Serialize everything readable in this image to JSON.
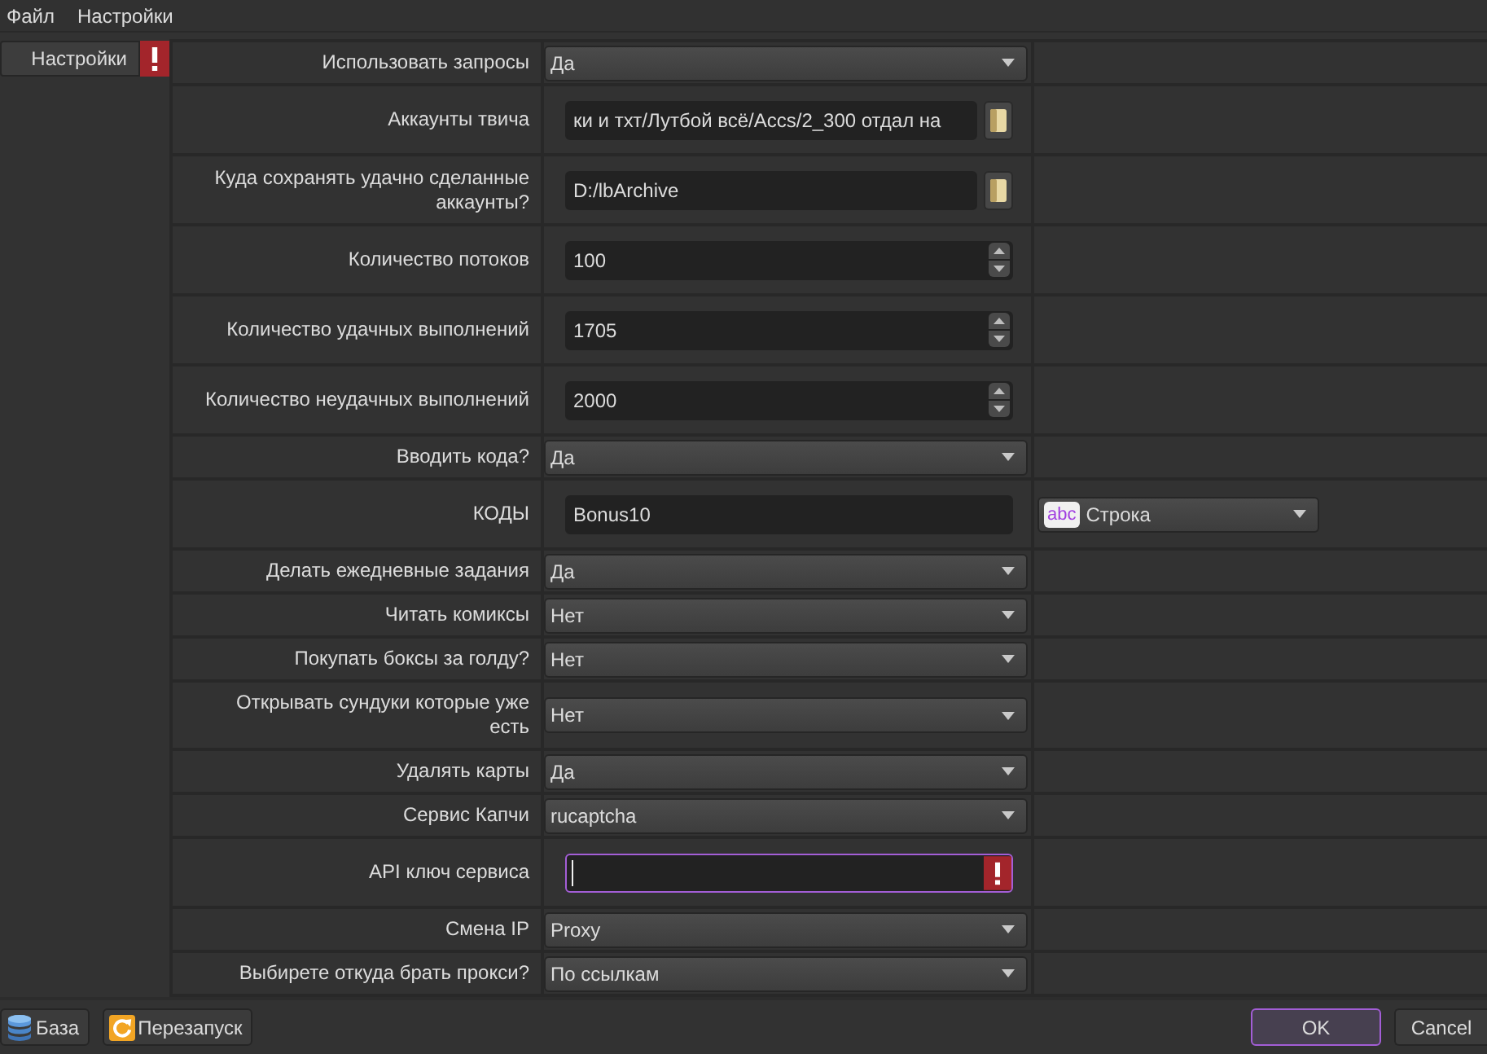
{
  "menu": [
    "Файл",
    "Настройки"
  ],
  "sidebar": {
    "items": [
      {
        "label": "Настройки",
        "selected": true,
        "warning": true
      }
    ]
  },
  "settings": [
    {
      "label": "Использовать запросы",
      "kind": "select",
      "value": "Да",
      "focused": false,
      "error": false
    },
    {
      "label": "Аккаунты твича",
      "kind": "path",
      "value": "ки и тхт/Лутбой всё/Accs/2_300 отдал на",
      "focused": false,
      "error": false
    },
    {
      "label": "Куда сохранять удачно сделанные аккаунты?",
      "kind": "path",
      "value": "D:/lbArchive",
      "focused": false,
      "error": false
    },
    {
      "label": "Количество потоков",
      "kind": "number",
      "value": "100",
      "focused": false,
      "error": false
    },
    {
      "label": "Количество удачных выполнений",
      "kind": "number",
      "value": "1705",
      "focused": false,
      "error": false
    },
    {
      "label": "Количество неудачных выполнений",
      "kind": "number",
      "value": "2000",
      "focused": false,
      "error": false
    },
    {
      "label": "Вводить кода?",
      "kind": "select",
      "value": "Да",
      "focused": false,
      "error": false
    },
    {
      "label": "КОДЫ",
      "kind": "text",
      "value": "Bonus10",
      "focused": false,
      "error": false,
      "type_select": {
        "tag": "abc",
        "value": "Строка"
      }
    },
    {
      "label": "Делать ежедневные задания",
      "kind": "select",
      "value": "Да",
      "focused": false,
      "error": false
    },
    {
      "label": "Читать комиксы",
      "kind": "select",
      "value": "Нет",
      "focused": false,
      "error": false
    },
    {
      "label": "Покупать боксы за голду?",
      "kind": "select",
      "value": "Нет",
      "focused": false,
      "error": false
    },
    {
      "label": "Открывать сундуки которые уже есть",
      "kind": "select",
      "value": "Нет",
      "focused": false,
      "error": false
    },
    {
      "label": "Удалять карты",
      "kind": "select",
      "value": "Да",
      "focused": false,
      "error": false
    },
    {
      "label": "Сервис Капчи",
      "kind": "select",
      "value": "rucaptcha",
      "focused": false,
      "error": false
    },
    {
      "label": "API ключ сервиса",
      "kind": "text",
      "focused": true,
      "error": true
    },
    {
      "label": "Смена IP",
      "kind": "select",
      "value": "Proxy",
      "focused": false,
      "error": false
    },
    {
      "label": "Выбирете откуда брать прокси?",
      "kind": "select",
      "value": "По ссылкам",
      "focused": false,
      "error": false
    }
  ],
  "footer": {
    "left": [
      "База",
      "Перезапуск"
    ],
    "right": [
      {
        "label": "OK",
        "default": true
      },
      {
        "label": "Cancel",
        "default": false
      }
    ]
  }
}
